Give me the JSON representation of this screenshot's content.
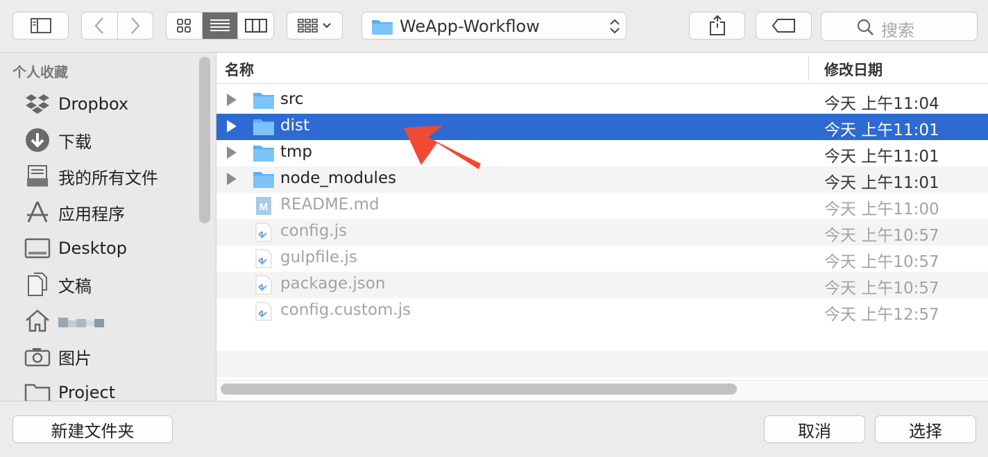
{
  "toolbar": {
    "path_folder": "WeApp-Workflow",
    "search_placeholder": "搜索"
  },
  "sidebar": {
    "section_title": "个人收藏",
    "items": [
      {
        "label": "Dropbox",
        "icon": "dropbox-icon"
      },
      {
        "label": "下载",
        "icon": "download-icon"
      },
      {
        "label": "我的所有文件",
        "icon": "all-files-icon"
      },
      {
        "label": "应用程序",
        "icon": "applications-icon"
      },
      {
        "label": "Desktop",
        "icon": "desktop-icon"
      },
      {
        "label": "文稿",
        "icon": "documents-icon"
      },
      {
        "label": "",
        "icon": "home-icon"
      },
      {
        "label": "图片",
        "icon": "camera-icon"
      },
      {
        "label": "Project",
        "icon": "folder-icon"
      }
    ]
  },
  "file_list": {
    "col_name": "名称",
    "col_date": "修改日期",
    "rows": [
      {
        "name": "src",
        "date": "今天 上午11:04",
        "type": "folder"
      },
      {
        "name": "dist",
        "date": "今天 上午11:01",
        "type": "folder",
        "selected": true
      },
      {
        "name": "tmp",
        "date": "今天 上午11:01",
        "type": "folder"
      },
      {
        "name": "node_modules",
        "date": "今天 上午11:01",
        "type": "folder"
      },
      {
        "name": "README.md",
        "date": "今天 上午11:00",
        "type": "markdown"
      },
      {
        "name": "config.js",
        "date": "今天 上午10:57",
        "type": "js"
      },
      {
        "name": "gulpfile.js",
        "date": "今天 上午10:57",
        "type": "js"
      },
      {
        "name": "package.json",
        "date": "今天 上午10:57",
        "type": "js"
      },
      {
        "name": "config.custom.js",
        "date": "今天 上午12:57",
        "type": "js"
      }
    ]
  },
  "footer": {
    "new_folder": "新建文件夹",
    "cancel": "取消",
    "choose": "选择"
  },
  "colors": {
    "selection": "#2d6ad1",
    "folder": "#5ab0f2",
    "annotation_arrow": "#f04b32"
  }
}
